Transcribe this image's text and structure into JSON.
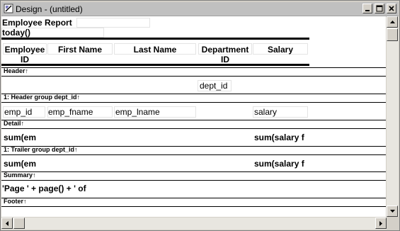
{
  "window": {
    "title": "Design - (untitled)"
  },
  "report": {
    "title": "Employee Report",
    "date_expr": "today()",
    "headers": {
      "emp_id": [
        "Employee",
        "ID"
      ],
      "first_name": "First Name",
      "last_name": "Last Name",
      "dept": [
        "Department",
        "ID"
      ],
      "salary": "Salary"
    },
    "bands": {
      "header": "Header↑",
      "group_header": "1: Header group dept_id↑",
      "detail": "Detail↑",
      "trailer": "1: Trailer group dept_id↑",
      "summary": "Summary↑",
      "footer": "Footer↑"
    },
    "group_header_field": "dept_id",
    "detail_fields": {
      "emp_id": "emp_id",
      "emp_fname": "emp_fname",
      "emp_lname": "emp_lname",
      "salary": "salary"
    },
    "detail_sums": {
      "left": "sum(em",
      "right": "sum(salary f"
    },
    "trailer_sums": {
      "left": "sum(em",
      "right": "sum(salary f"
    },
    "summary_expr": "'Page ' + page() + ' of"
  },
  "icons": {
    "app": "design-window-icon",
    "minimize": "minimize-icon",
    "maximize": "maximize-icon",
    "close": "close-icon"
  }
}
